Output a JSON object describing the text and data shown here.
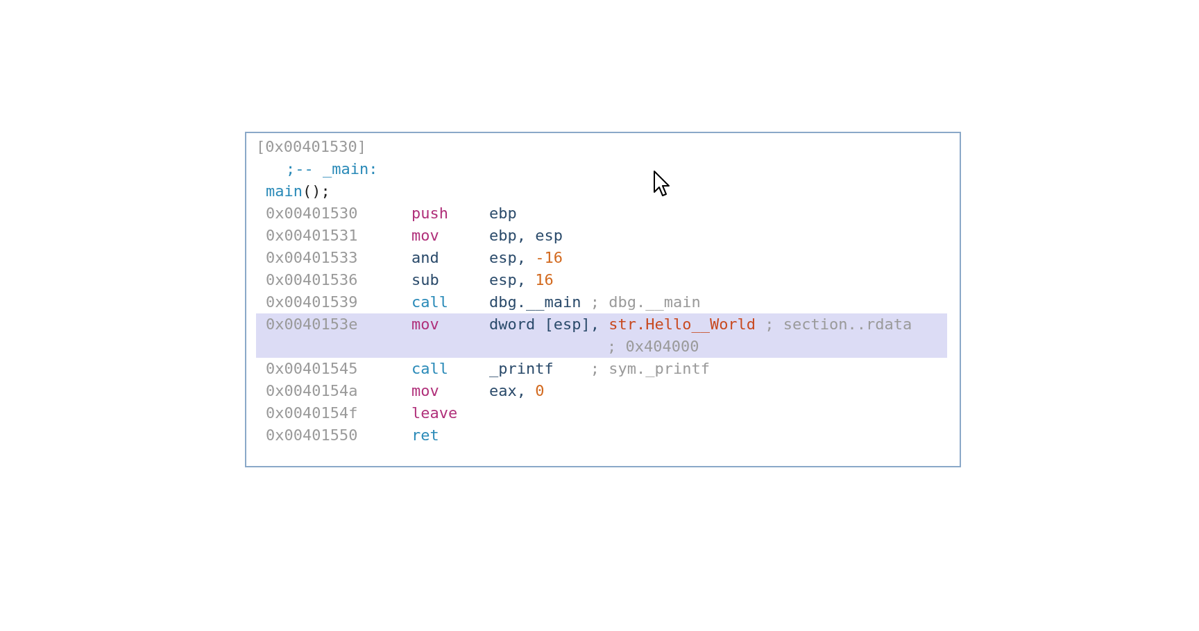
{
  "block": {
    "header": "[0x00401530]",
    "label": ";-- _main:",
    "function_call": {
      "name": "main",
      "rest": "();"
    },
    "rows": [
      {
        "address": "0x00401530",
        "mnemonic": {
          "text": "push",
          "kind": "stack"
        },
        "operands": [
          {
            "text": "ebp",
            "kind": "reg"
          }
        ],
        "selected": false
      },
      {
        "address": "0x00401531",
        "mnemonic": {
          "text": "mov",
          "kind": "stack"
        },
        "operands": [
          {
            "text": "ebp, esp",
            "kind": "reg"
          }
        ],
        "selected": false
      },
      {
        "address": "0x00401533",
        "mnemonic": {
          "text": "and",
          "kind": "math"
        },
        "operands": [
          {
            "text": "esp, ",
            "kind": "reg"
          },
          {
            "text": "-16",
            "kind": "num"
          }
        ],
        "selected": false
      },
      {
        "address": "0x00401536",
        "mnemonic": {
          "text": "sub",
          "kind": "math"
        },
        "operands": [
          {
            "text": "esp, ",
            "kind": "reg"
          },
          {
            "text": "16",
            "kind": "num"
          }
        ],
        "selected": false
      },
      {
        "address": "0x00401539",
        "mnemonic": {
          "text": "call",
          "kind": "flow"
        },
        "operands": [
          {
            "text": "dbg.__main",
            "kind": "reg"
          }
        ],
        "comments": [
          "; dbg.__main"
        ],
        "selected": false
      },
      {
        "address": "0x0040153e",
        "mnemonic": {
          "text": "mov",
          "kind": "stack"
        },
        "operands": [
          {
            "text": "dword [esp], ",
            "kind": "reg"
          },
          {
            "text": "str.Hello__World",
            "kind": "str"
          }
        ],
        "comments": [
          "; section..rdata",
          "; 0x404000"
        ],
        "selected": true
      },
      {
        "address": "0x00401545",
        "mnemonic": {
          "text": "call",
          "kind": "flow"
        },
        "operands": [
          {
            "text": "_printf",
            "kind": "reg"
          }
        ],
        "comments": [
          "; sym._printf"
        ],
        "selected": false
      },
      {
        "address": "0x0040154a",
        "mnemonic": {
          "text": "mov",
          "kind": "stack"
        },
        "operands": [
          {
            "text": "eax, ",
            "kind": "reg"
          },
          {
            "text": "0",
            "kind": "num"
          }
        ],
        "selected": false
      },
      {
        "address": "0x0040154f",
        "mnemonic": {
          "text": "leave",
          "kind": "stack"
        },
        "selected": false
      },
      {
        "address": "0x00401550",
        "mnemonic": {
          "text": "ret",
          "kind": "flow"
        },
        "selected": false
      }
    ]
  }
}
